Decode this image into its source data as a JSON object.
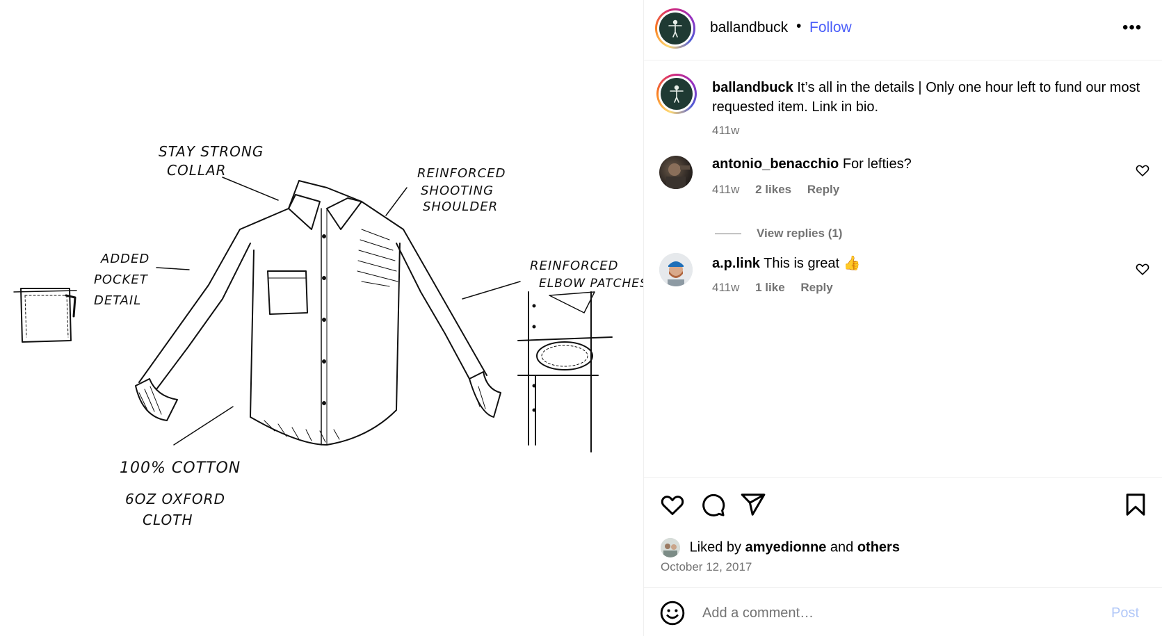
{
  "post": {
    "username": "ballandbuck",
    "follow_label": "Follow",
    "dot": "•",
    "more_label": "•••"
  },
  "sketch": {
    "labels": {
      "collar_1": "STAY STRONG",
      "collar_2": "COLLAR",
      "shoulder_1": "REINFORCED",
      "shoulder_2": "SHOOTING",
      "shoulder_3": "SHOULDER",
      "pocket_1": "ADDED",
      "pocket_2": "POCKET",
      "pocket_3": "DETAIL",
      "elbow_1": "REINFORCED",
      "elbow_2": "ELBOW PATCHES",
      "cotton_1": "100% COTTON",
      "cotton_2": "6OZ OXFORD",
      "cotton_3": "CLOTH"
    }
  },
  "caption": {
    "username": "ballandbuck",
    "text": "It’s all in the details | Only one hour left to fund our most requested item. Link in bio.",
    "time": "411w"
  },
  "comments": [
    {
      "username": "antonio_benacchio",
      "text": "For lefties?",
      "time": "411w",
      "likes": "2 likes",
      "reply": "Reply"
    },
    {
      "username": "a.p.link",
      "text": "This is great 👍",
      "time": "411w",
      "likes": "1 like",
      "reply": "Reply"
    }
  ],
  "view_replies": "View replies (1)",
  "liked_by": {
    "prefix": "Liked by",
    "user": "amyedionne",
    "and": "and",
    "others": "others"
  },
  "date": "October 12, 2017",
  "add_comment": {
    "placeholder": "Add a comment…",
    "post_label": "Post"
  },
  "colors": {
    "accent": "#4a5df9",
    "muted": "#737373",
    "post_disabled": "#b2c8f8",
    "brand_avatar": "#1f3a33"
  },
  "icons": [
    "heart-icon",
    "comment-icon",
    "share-icon",
    "bookmark-icon",
    "emoji-icon",
    "more-icon"
  ]
}
